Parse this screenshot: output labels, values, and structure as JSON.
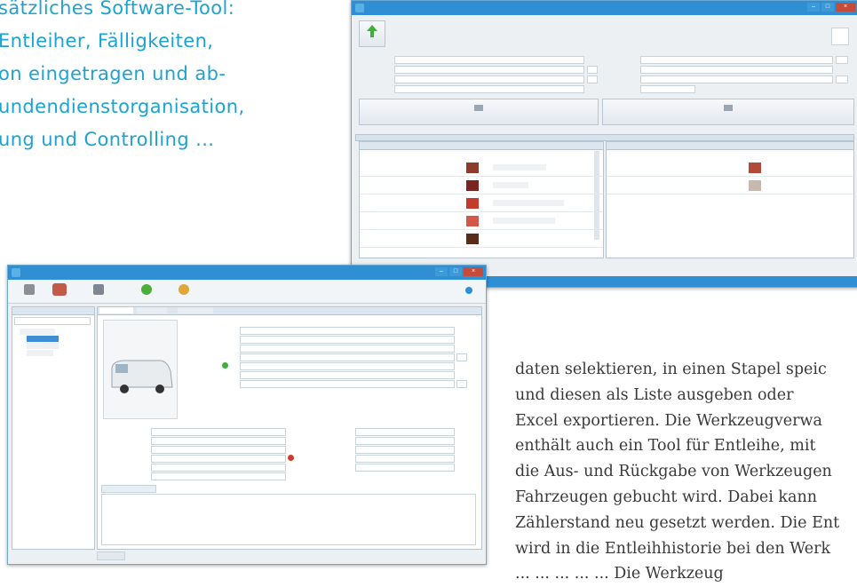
{
  "intro_lines": [
    "sätzliches Software-Tool:",
    "Entleiher, Fälligkeiten,",
    "on eingetragen und ab-",
    "undendienstorganisation,",
    "ung und Controlling ..."
  ],
  "body_lines": [
    "daten selektieren, in einen Stapel speic",
    "und diesen als Liste ausgeben oder",
    "Excel exportieren. Die Werkzeugverwa",
    "enthält auch ein Tool für Entleihe, mit",
    "die Aus- und Rückgabe von Werkzeugen",
    "Fahrzeugen gebucht wird. Dabei kann",
    "Zählerstand neu gesetzt werden. Die Ent",
    "wird in die Entleihhistorie bei den Werk",
    "... ... ... ... ... Die Werkzeug"
  ],
  "colors": {
    "intro_text": "#1da3d2",
    "window_titlebar": "#2f8fd2",
    "close_button": "#c74b3b"
  },
  "screenshot_a": {
    "icons": [
      "green-arrow-icon",
      "minimize-icon",
      "maximize-icon",
      "close-icon",
      "ausgabe-icon",
      "rueckgabe-icon"
    ]
  },
  "screenshot_b": {
    "icons": [
      "werkzeug-icon",
      "fahrzeug-icon",
      "add-icon",
      "gear-icon",
      "van-photo",
      "status-dot-icon"
    ]
  }
}
